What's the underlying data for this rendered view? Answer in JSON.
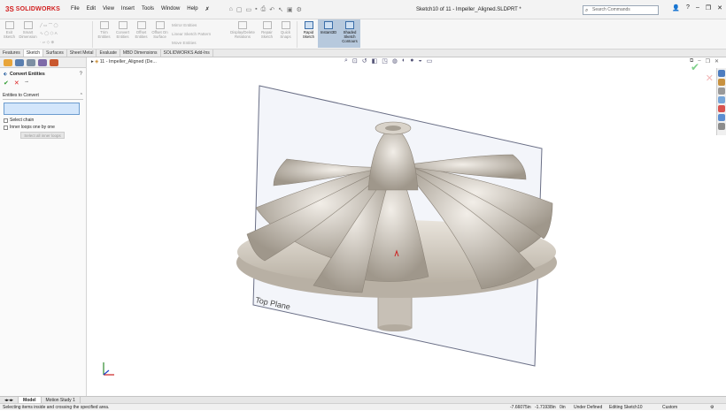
{
  "app": {
    "logo": "SOLIDWORKS",
    "menu": [
      "File",
      "Edit",
      "View",
      "Insert",
      "Tools",
      "Window",
      "Help"
    ],
    "doc_title": "Sketch10 of 11 - Impeller_Aligned.SLDPRT *",
    "search_placeholder": "Search Commands"
  },
  "ribbon": {
    "buttons": [
      {
        "label": "Exit Sketch",
        "state": "disabled"
      },
      {
        "label": "Smart Dimension",
        "state": "disabled"
      },
      {
        "label": "Trim Entities",
        "state": "disabled"
      },
      {
        "label": "Convert Entities",
        "state": "disabled"
      },
      {
        "label": "Offset Entities",
        "state": "disabled"
      },
      {
        "label": "Offset On Surface",
        "state": "disabled"
      }
    ],
    "small": [
      "Mirror Entities",
      "Linear Sketch Pattern",
      "Move Entities"
    ],
    "buttons2": [
      {
        "label": "Display/Delete Relations",
        "state": "disabled"
      },
      {
        "label": "Repair Sketch",
        "state": "disabled"
      },
      {
        "label": "Quick Snaps",
        "state": "disabled"
      },
      {
        "label": "Rapid Sketch",
        "state": "active"
      },
      {
        "label": "Instant3D",
        "state": "selected"
      },
      {
        "label": "Shaded Sketch Contours",
        "state": "selected"
      }
    ]
  },
  "tabs": [
    "Features",
    "Sketch",
    "Surfaces",
    "Sheet Metal",
    "Evaluate",
    "MBD Dimensions",
    "SOLIDWORKS Add-Ins"
  ],
  "active_tab": "Sketch",
  "property_manager": {
    "title": "Convert Entities",
    "group_label": "Entities to Convert",
    "select_chain": "Select chain",
    "inner_loops": "Inner loops one by one",
    "select_all_button": "Select all inner loops"
  },
  "viewport": {
    "tree_node": "11 - Impeller_Aligned  (De...",
    "plane_label": "Top Plane"
  },
  "bottom_tabs": [
    "Model",
    "Motion Study 1"
  ],
  "status": {
    "message": "Selecting items inside and crossing the specified area.",
    "x": "-7.66075in",
    "y": "-1.71938in",
    "z": "0in",
    "definition": "Under Defined",
    "editing": "Editing Sketch10",
    "units": "Custom"
  },
  "colors": {
    "accent_red": "#d21f1f",
    "ok_green": "#2f9c2f",
    "selection_blue": "#d3e6fb"
  }
}
